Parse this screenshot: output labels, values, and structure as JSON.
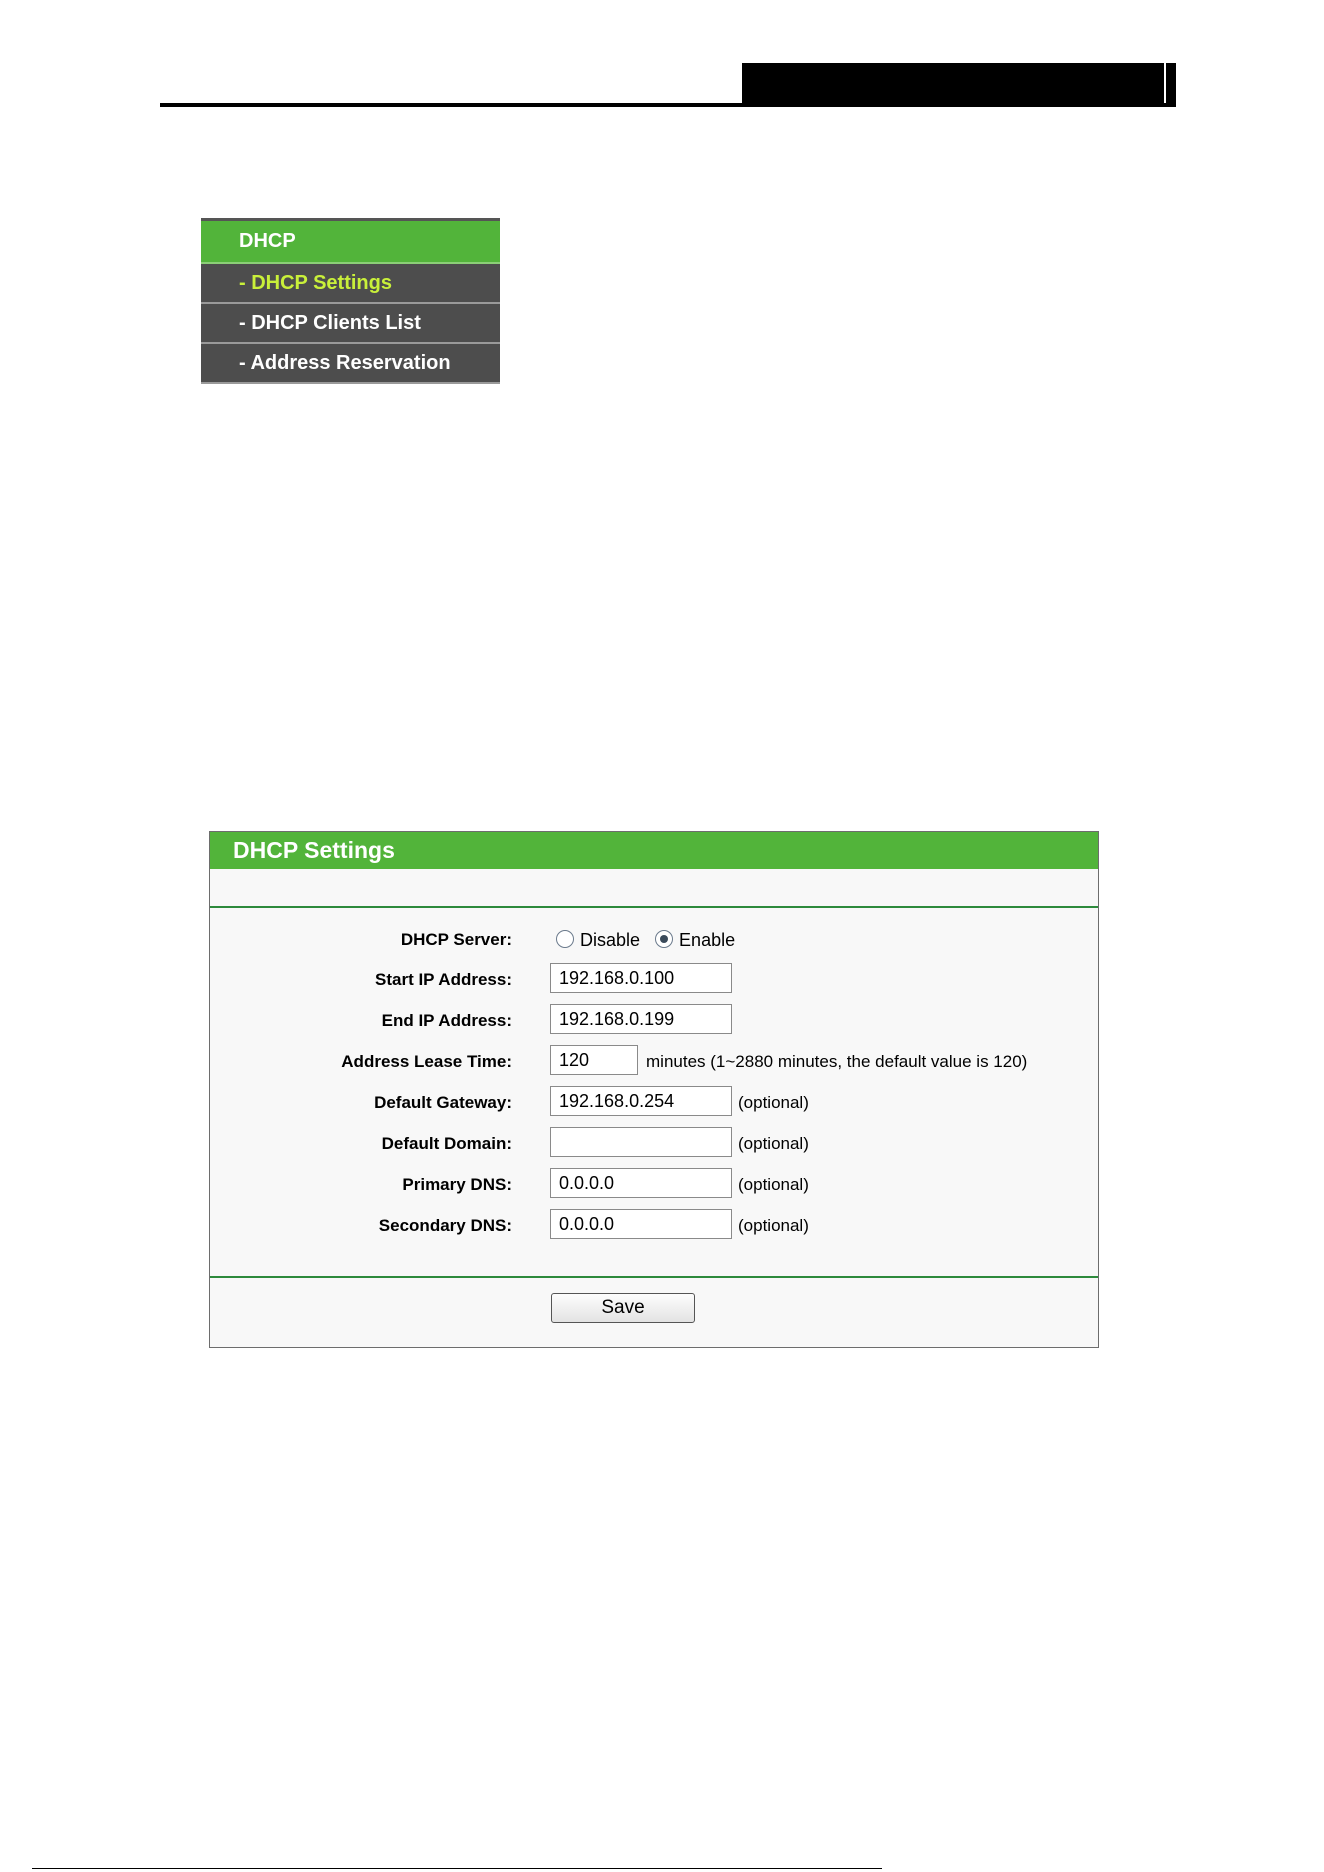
{
  "menu": {
    "heading": "DHCP",
    "items": [
      {
        "label": "- DHCP Settings",
        "active": true
      },
      {
        "label": "- DHCP Clients List",
        "active": false
      },
      {
        "label": "- Address Reservation",
        "active": false
      }
    ]
  },
  "panel": {
    "title": "DHCP Settings",
    "dhcp_server": {
      "label": "DHCP Server:",
      "options": [
        "Disable",
        "Enable"
      ],
      "selected": "Enable"
    },
    "fields": {
      "start_ip": {
        "label": "Start IP Address:",
        "value": "192.168.0.100"
      },
      "end_ip": {
        "label": "End IP Address:",
        "value": "192.168.0.199"
      },
      "lease_time": {
        "label": "Address Lease Time:",
        "value": "120",
        "note": "minutes (1~2880 minutes, the default value is 120)"
      },
      "gateway": {
        "label": "Default Gateway:",
        "value": "192.168.0.254",
        "note": "(optional)"
      },
      "domain": {
        "label": "Default Domain:",
        "value": "",
        "note": "(optional)"
      },
      "primary_dns": {
        "label": "Primary DNS:",
        "value": "0.0.0.0",
        "note": "(optional)"
      },
      "secondary_dns": {
        "label": "Secondary DNS:",
        "value": "0.0.0.0",
        "note": "(optional)"
      }
    },
    "save_label": "Save"
  },
  "colors": {
    "accent_green": "#52b43a",
    "menu_dark": "#4d4d4d",
    "active_text": "#c9f03a"
  }
}
